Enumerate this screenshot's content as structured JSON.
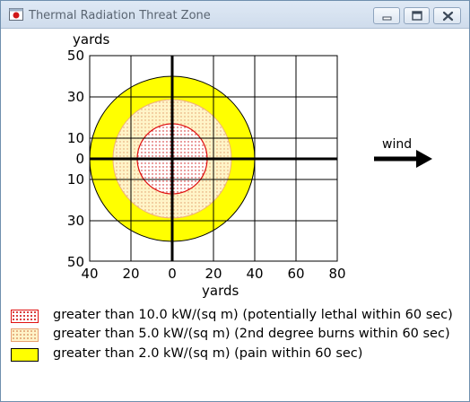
{
  "window": {
    "title": "Thermal Radiation Threat Zone"
  },
  "plot": {
    "y_axis_label": "yards",
    "x_axis_label": "yards",
    "y_ticks_top": [
      "50",
      "30",
      "10",
      "0"
    ],
    "y_ticks_bottom": [
      "10",
      "30",
      "50"
    ],
    "x_ticks": [
      "40",
      "20",
      "0",
      "20",
      "40",
      "60",
      "80"
    ],
    "wind_label": "wind"
  },
  "legend": {
    "items": [
      {
        "label": "greater than 10.0 kW/(sq m) (potentially lethal within 60 sec)",
        "color": "#e01010"
      },
      {
        "label": "greater than 5.0 kW/(sq m) (2nd degree burns within 60 sec)",
        "color": "#f5c89a"
      },
      {
        "label": "greater than 2.0 kW/(sq m) (pain within 60 sec)",
        "color": "#ffff00"
      }
    ]
  },
  "icons": {
    "app": "app-icon",
    "minimize": "minimize-icon",
    "maximize": "maximize-icon",
    "close": "close-icon",
    "wind": "wind-arrow-icon"
  },
  "zones": {
    "red_radius_yards": 20,
    "orange_radius_yards": 30,
    "yellow_radius_yards": 40,
    "center_x_yards": 0,
    "center_y_yards": 0
  }
}
